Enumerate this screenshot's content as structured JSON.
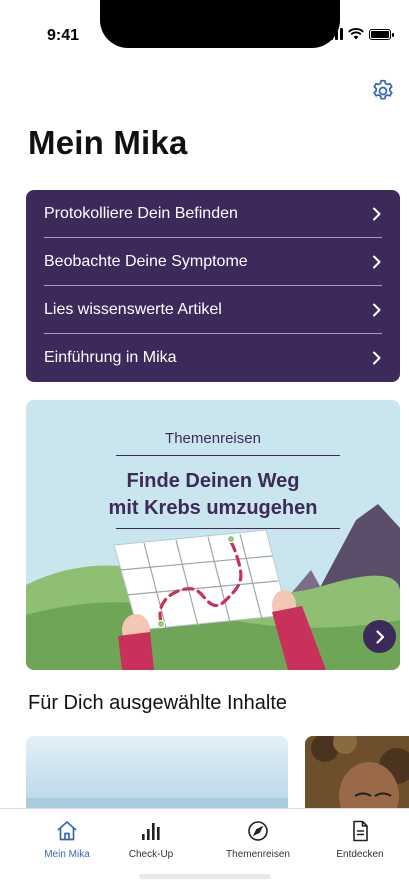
{
  "status_bar": {
    "time": "9:41"
  },
  "header": {
    "title": "Mein Mika",
    "settings_icon": "gear-icon"
  },
  "menu": {
    "items": [
      {
        "label": "Protokolliere Dein Befinden"
      },
      {
        "label": "Beobachte Deine Symptome"
      },
      {
        "label": "Lies wissenswerte Artikel"
      },
      {
        "label": "Einführung in Mika"
      }
    ]
  },
  "journey_card": {
    "overline": "Themenreisen",
    "headline_line1": "Finde Deinen Weg",
    "headline_line2": "mit Krebs umzugehen"
  },
  "section": {
    "title": "Für Dich ausgewählte Inhalte"
  },
  "tab_bar": {
    "tabs": [
      {
        "label": "Mein Mika",
        "icon": "home-icon",
        "active": true
      },
      {
        "label": "Check-Up",
        "icon": "bar-chart-icon",
        "active": false
      },
      {
        "label": "Themenreisen",
        "icon": "compass-icon",
        "active": false
      },
      {
        "label": "Entdecken",
        "icon": "document-icon",
        "active": false
      }
    ]
  },
  "colors": {
    "brand_purple": "#3d2a5a",
    "accent_blue": "#3b66b3",
    "journey_bg": "#c9e6ee",
    "route_red": "#c8325a"
  }
}
